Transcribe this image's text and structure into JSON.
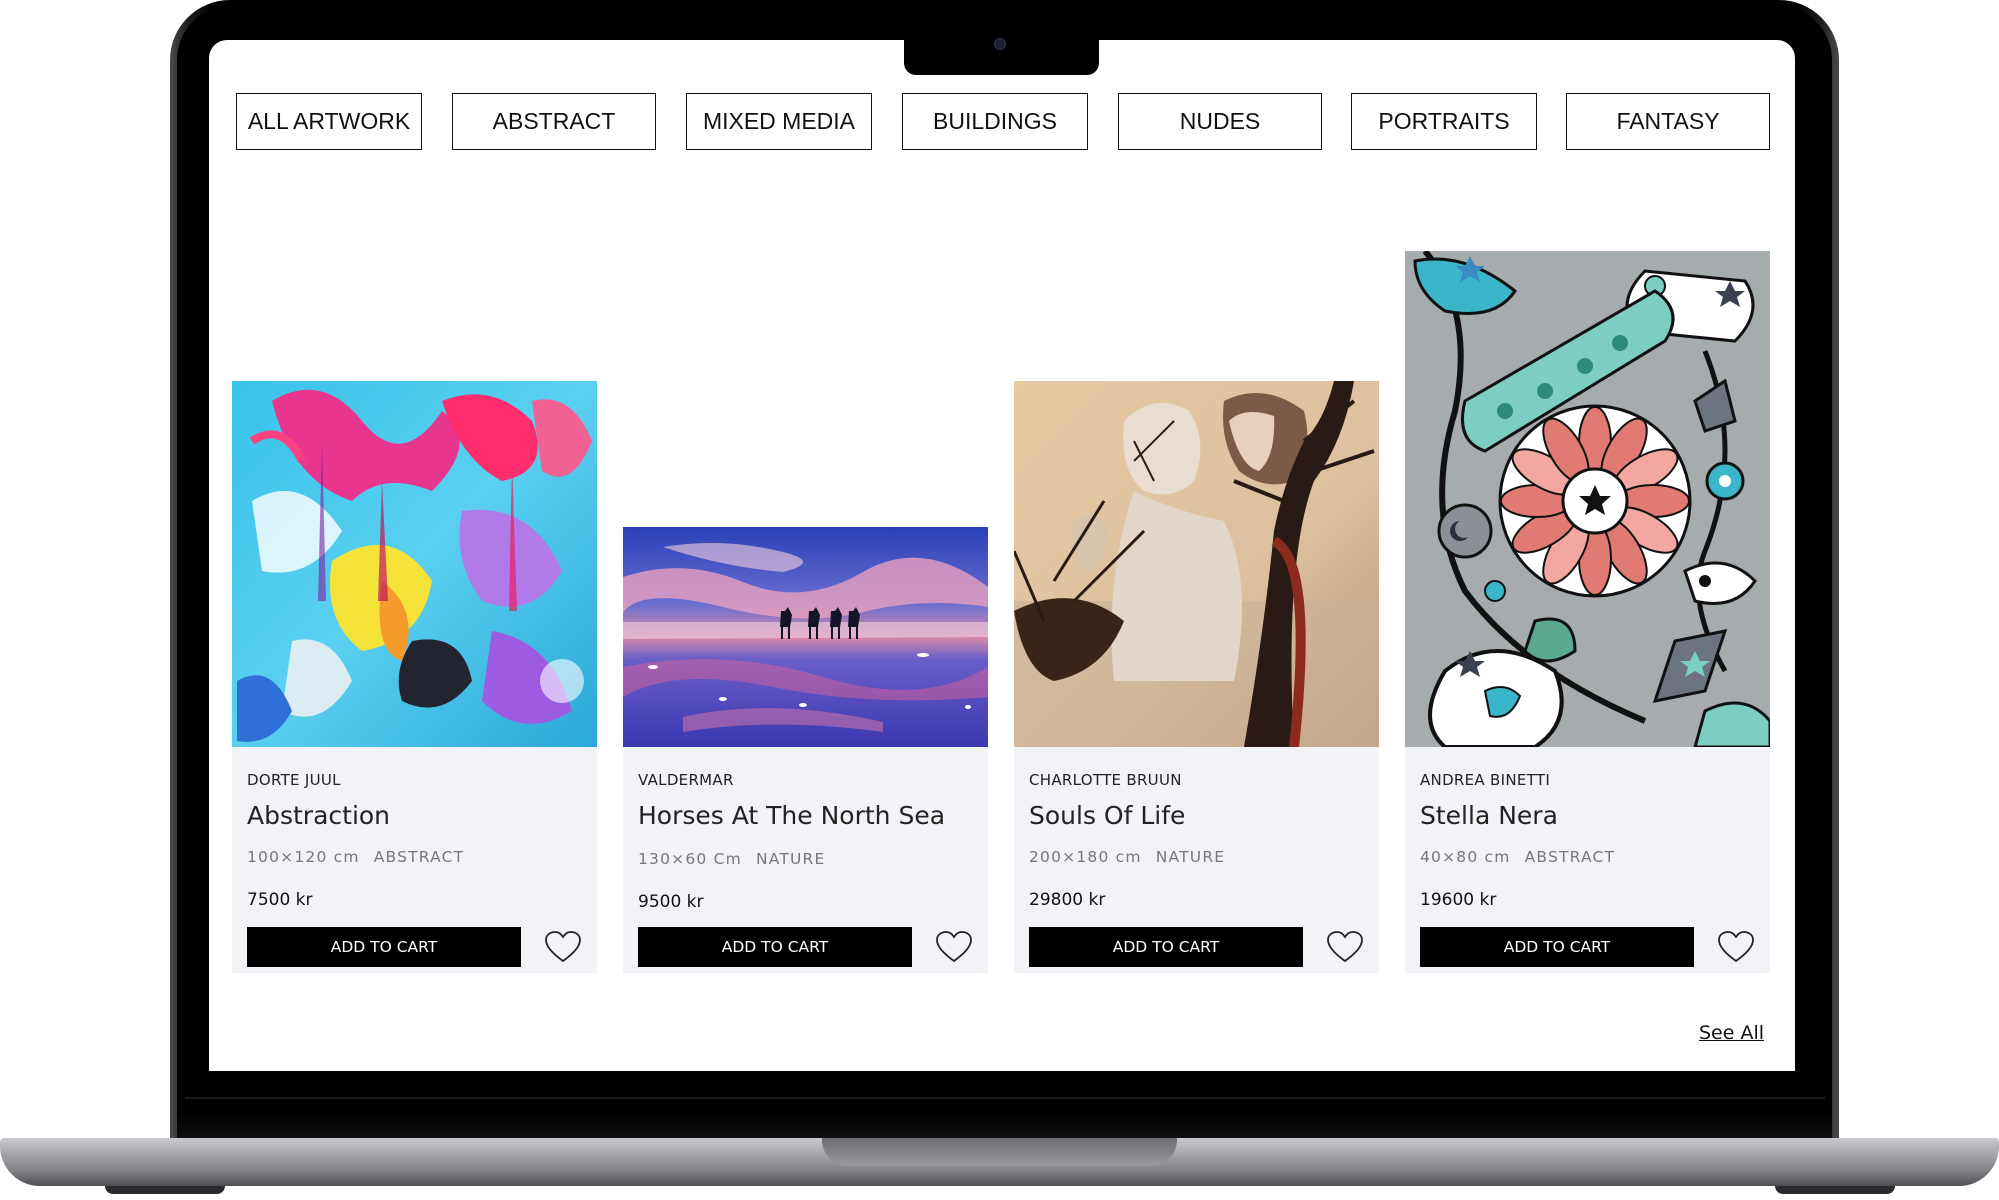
{
  "categories": [
    {
      "label": "ALL ARTWORK"
    },
    {
      "label": "ABSTRACT"
    },
    {
      "label": "MIXED MEDIA"
    },
    {
      "label": "BUILDINGS"
    },
    {
      "label": "NUDES"
    },
    {
      "label": "PORTRAITS"
    },
    {
      "label": "FANTASY"
    }
  ],
  "products": [
    {
      "artist": "DORTE JUUL",
      "title": "Abstraction",
      "size": "100×120 cm",
      "category": "ABSTRACT",
      "price": "7500 kr",
      "cart_label": "ADD TO CART"
    },
    {
      "artist": "VALDERMAR",
      "title": "Horses At The North Sea",
      "size": "130×60 Cm",
      "category": "NATURE",
      "price": "9500 kr",
      "cart_label": "ADD TO CART"
    },
    {
      "artist": "CHARLOTTE BRUUN",
      "title": "Souls Of Life",
      "size": "200×180 cm",
      "category": "NATURE",
      "price": "29800 kr",
      "cart_label": "ADD TO CART"
    },
    {
      "artist": "ANDREA BINETTI",
      "title": "Stella Nera",
      "size": "40×80 cm",
      "category": "ABSTRACT",
      "price": "19600 kr",
      "cart_label": "ADD TO CART"
    }
  ],
  "see_all_label": "See All",
  "icons": {
    "favorite": "heart-icon"
  },
  "colors": {
    "button_bg": "#000000",
    "card_bg": "#f2f3f7",
    "border": "#111111"
  }
}
